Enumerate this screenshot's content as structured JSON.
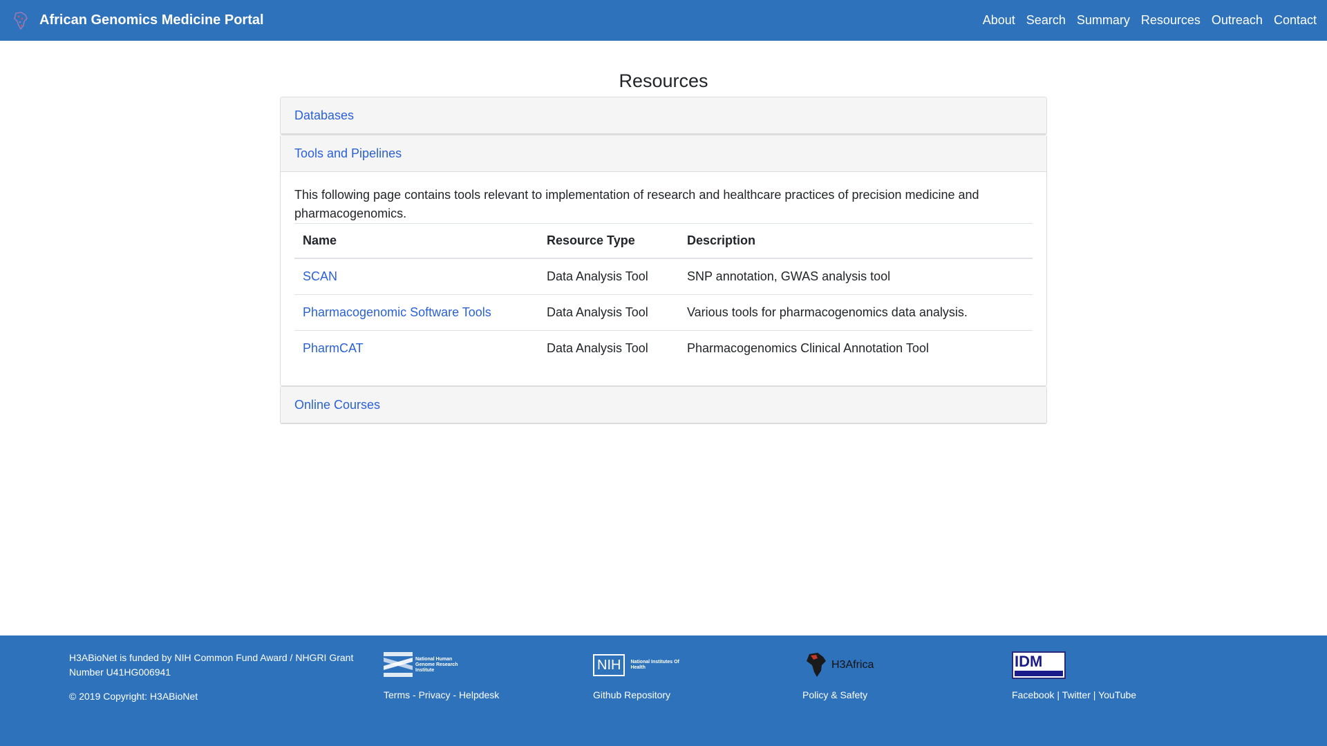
{
  "navbar": {
    "brand": "African Genomics Medicine Portal",
    "links": [
      "About",
      "Search",
      "Summary",
      "Resources",
      "Outreach",
      "Contact"
    ]
  },
  "page": {
    "title": "Resources"
  },
  "accordion": {
    "databases": "Databases",
    "tools": "Tools and Pipelines",
    "courses": "Online Courses"
  },
  "tools_section": {
    "intro": "This following page contains tools relevant to implementation of research and healthcare practices of precision medicine and pharmacogenomics.",
    "headers": [
      "Name",
      "Resource Type",
      "Description"
    ],
    "rows": [
      {
        "name": "SCAN",
        "type": "Data Analysis Tool",
        "description": "SNP annotation, GWAS analysis tool"
      },
      {
        "name": "Pharmacogenomic Software Tools",
        "type": "Data Analysis Tool",
        "description": "Various tools for pharmacogenomics data analysis."
      },
      {
        "name": "PharmCAT",
        "type": "Data Analysis Tool",
        "description": "Pharmacogenomics Clinical Annotation Tool"
      }
    ]
  },
  "footer": {
    "funding": "H3ABioNet is funded by NIH Common Fund Award / NHGRI Grant Number U41HG006941",
    "copyright": "© 2019 Copyright: H3ABioNet",
    "nhgri_logo_text": "National Human Genome Research Institute",
    "nih_logo_text": "NIH",
    "nih_logo_sub": "National Institutes Of Health",
    "h3africa_logo_text": "H3Africa",
    "idm_logo_text": "IDM",
    "col2_links": {
      "terms": "Terms",
      "sep1": " - ",
      "privacy": "Privacy",
      "sep2": " - ",
      "helpdesk": "Helpdesk"
    },
    "col3_link": "Github Repository",
    "col4_link": "Policy & Safety",
    "col5_links": {
      "facebook": "Facebook",
      "sep1": " | ",
      "twitter": "Twitter",
      "sep2": " | ",
      "youtube": "YouTube"
    }
  },
  "colors": {
    "navbar": "#2e72bc",
    "link": "#2a61d8",
    "footer": "#2e72bc"
  }
}
